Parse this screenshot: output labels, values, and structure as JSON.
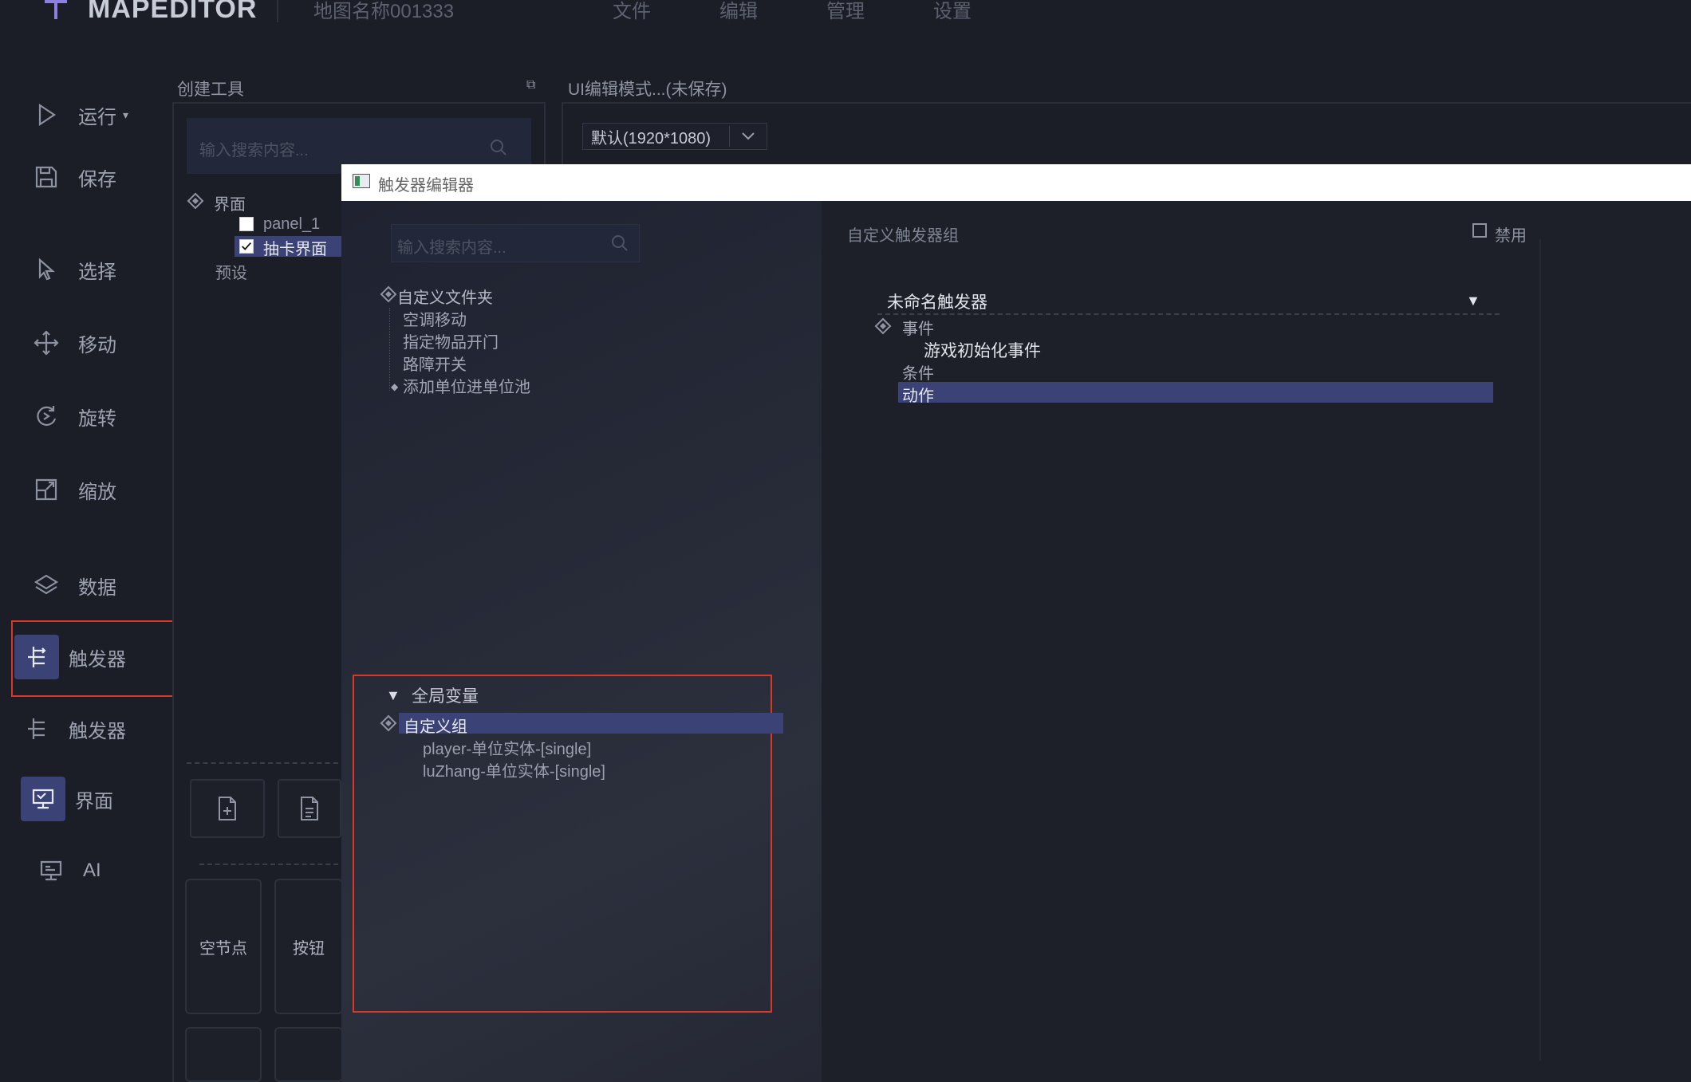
{
  "app": {
    "title": "MAPEDITOR",
    "map_name": "地图名称001333",
    "menu": [
      "文件",
      "编辑",
      "管理",
      "设置"
    ]
  },
  "sidebar": {
    "items": [
      {
        "label": "运行",
        "icon": "play-icon"
      },
      {
        "label": "保存",
        "icon": "save-icon"
      },
      {
        "label": "选择",
        "icon": "cursor-icon"
      },
      {
        "label": "移动",
        "icon": "move-icon"
      },
      {
        "label": "旋转",
        "icon": "rotate-icon"
      },
      {
        "label": "缩放",
        "icon": "scale-icon"
      },
      {
        "label": "数据",
        "icon": "layers-icon"
      },
      {
        "label": "触发器",
        "icon": "trigger-icon",
        "active": true
      },
      {
        "label": "触发器",
        "icon": "trigger-icon"
      },
      {
        "label": "界面",
        "icon": "ui-icon",
        "active": true
      },
      {
        "label": "AI",
        "icon": "ai-icon"
      }
    ]
  },
  "create_tools": {
    "title": "创建工具",
    "search_placeholder": "输入搜索内容...",
    "tree": {
      "root": "界面",
      "children": [
        "panel_1",
        "抽卡界面"
      ],
      "preset": "预设"
    },
    "tiles": [
      "空节点",
      "按钮"
    ]
  },
  "ui_edit": {
    "title": "UI编辑模式...(未保存)",
    "resolution": "默认(1920*1080)"
  },
  "trigger_editor": {
    "window_title": "触发器编辑器",
    "search_placeholder": "输入搜索内容...",
    "folder": {
      "root": "自定义文件夹",
      "items": [
        "空调移动",
        "指定物品开门",
        "路障开关",
        "添加单位进单位池"
      ]
    },
    "global_vars": {
      "title": "全局变量",
      "group": "自定义组",
      "vars": [
        "player-单位实体-[single]",
        "luZhang-单位实体-[single]"
      ]
    },
    "group_title": "自定义触发器组",
    "disable_label": "禁用",
    "trigger": {
      "name": "未命名触发器",
      "event_label": "事件",
      "event_item": "游戏初始化事件",
      "condition_label": "条件",
      "action_label": "动作"
    }
  },
  "colors": {
    "accent": "#3b4275",
    "highlight_box": "#d8372a",
    "background": "#1b1e27"
  }
}
